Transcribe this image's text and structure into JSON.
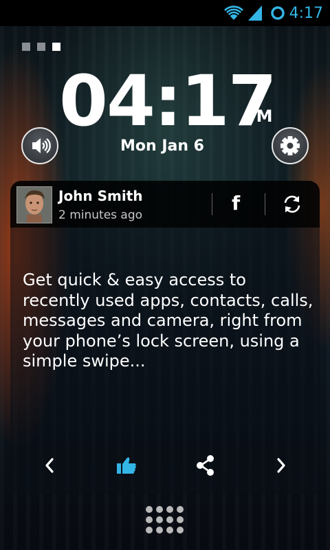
{
  "status_bar": {
    "time": "4:17",
    "icons": [
      "wifi-icon",
      "signal-icon",
      "sync-circle-icon"
    ],
    "accent_color": "#33b5e5"
  },
  "pager": {
    "count": 3,
    "active_index": 2
  },
  "clock": {
    "time": "04:17",
    "ampm": "PM",
    "date": "Mon Jan 6"
  },
  "buttons": {
    "sound": "speaker-icon",
    "settings": "gear-icon"
  },
  "notification": {
    "name": "John Smith",
    "time_ago": "2 minutes ago",
    "source": "f",
    "message": "Get quick & easy access to recently used apps, contacts, calls, messages and camera, right from your phone’s lock screen, using a simple swipe..."
  },
  "actions": {
    "icons": [
      "chevron-left-icon",
      "thumbs-up-icon",
      "share-icon",
      "chevron-right-icon"
    ],
    "like_color": "#33b5e5"
  },
  "app_drawer": {
    "icon": "grid-dots-icon"
  }
}
